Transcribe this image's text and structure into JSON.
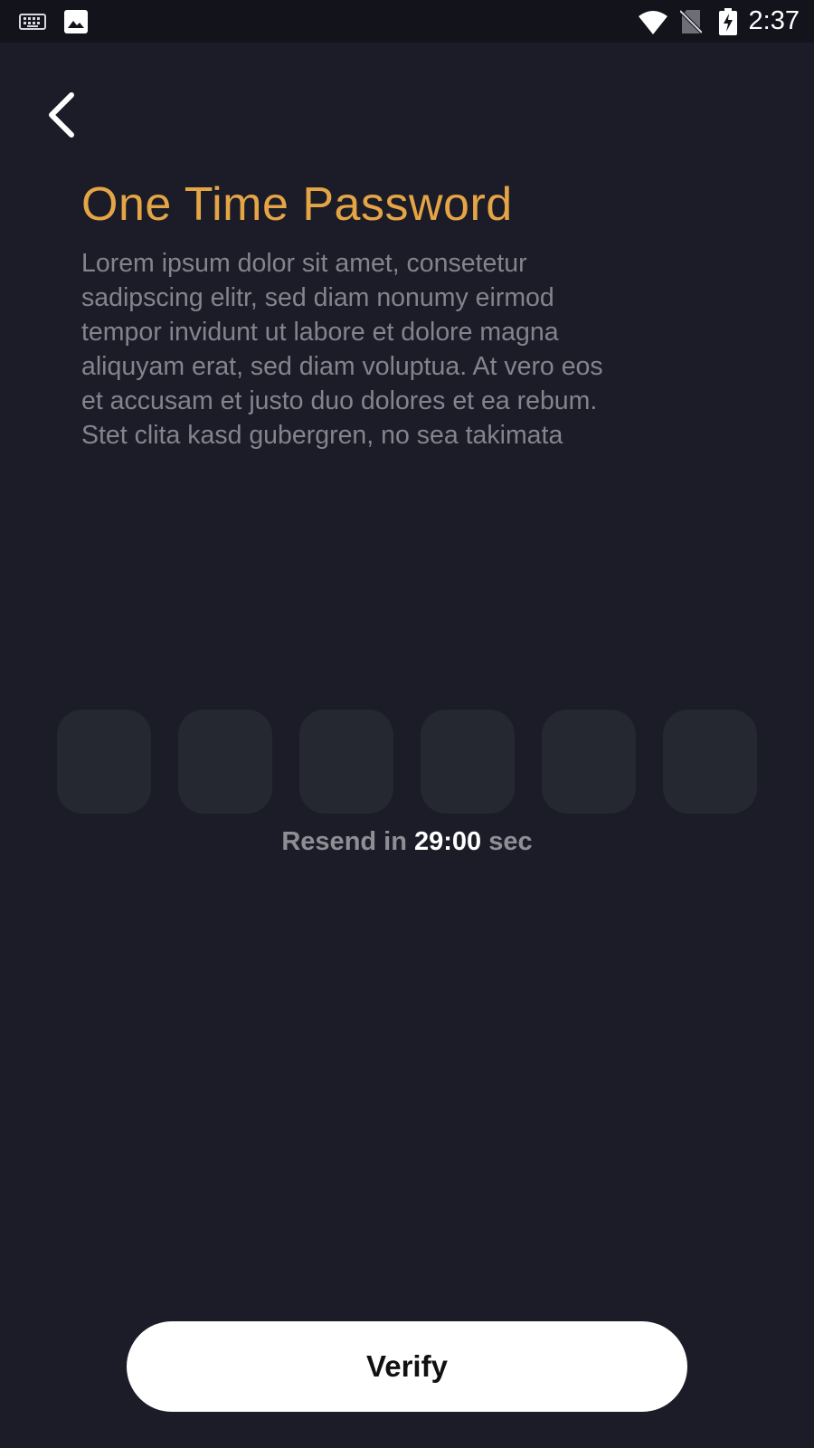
{
  "status_bar": {
    "time": "2:37",
    "left_icons": [
      "keyboard-icon",
      "image-icon"
    ],
    "right_icons": [
      "wifi-icon",
      "no-sim-icon",
      "battery-charging-icon"
    ]
  },
  "header": {
    "back_icon": "chevron-left-icon",
    "title": "One Time Password",
    "description": "Lorem ipsum dolor sit amet, consetetur sadipscing elitr, sed diam nonumy eirmod tempor invidunt ut labore et dolore magna aliquyam erat, sed diam voluptua. At vero eos et accusam et justo duo dolores et ea rebum. Stet clita kasd gubergren, no sea takimata"
  },
  "otp": {
    "digits": [
      "",
      "",
      "",
      "",
      "",
      ""
    ]
  },
  "resend": {
    "prefix": "Resend in",
    "timer": "29:00",
    "suffix": "sec"
  },
  "actions": {
    "verify_label": "Verify"
  },
  "colors": {
    "background": "#1b1c27",
    "status_bar": "#12131b",
    "title": "#e5a546",
    "description": "#83848c",
    "otp_box": "#252731",
    "button": "#ffffff"
  }
}
